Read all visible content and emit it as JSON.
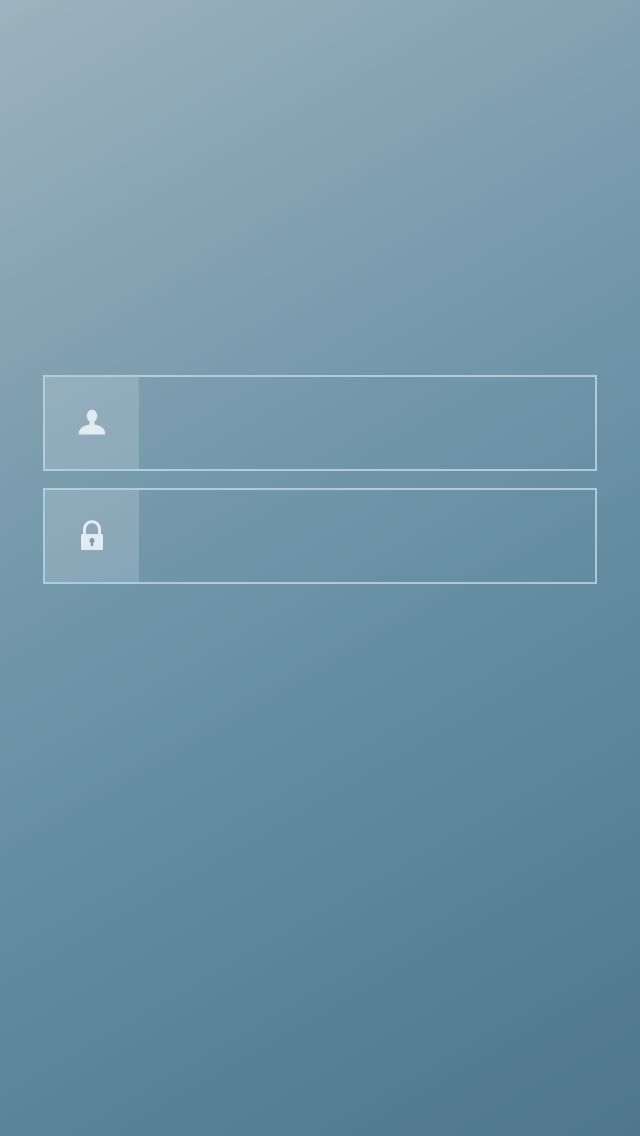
{
  "login": {
    "username": {
      "icon": "user-icon",
      "value": "",
      "placeholder": ""
    },
    "password": {
      "icon": "lock-icon",
      "value": "",
      "placeholder": ""
    }
  },
  "colors": {
    "background_top_left": "#9db3be",
    "background_bottom_right": "#4f768b",
    "field_border": "#c4deea",
    "icon": "#e2ecf0"
  }
}
